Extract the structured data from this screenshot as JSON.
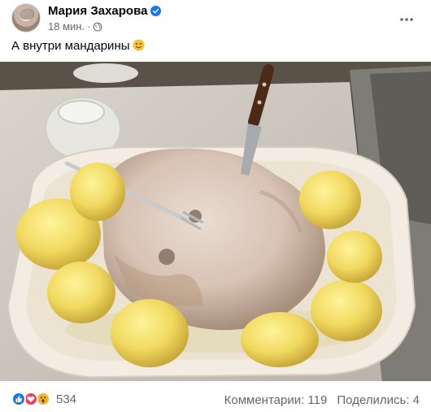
{
  "post": {
    "author": "Мария Захарова",
    "time": "18 мин.",
    "separator": "·",
    "text": "А внутри мандарины",
    "emoji": "winking-face-icon"
  },
  "icons": {
    "verified": "verified-badge-icon",
    "audience": "globe-icon",
    "menu": "more-horizontal-icon"
  },
  "footer": {
    "reactions_count": "534",
    "comments": "Комментарии: 119",
    "shares": "Поделились: 4"
  },
  "colors": {
    "accent": "#1877f2",
    "text": "#050505",
    "secondary_text": "#65676b"
  }
}
